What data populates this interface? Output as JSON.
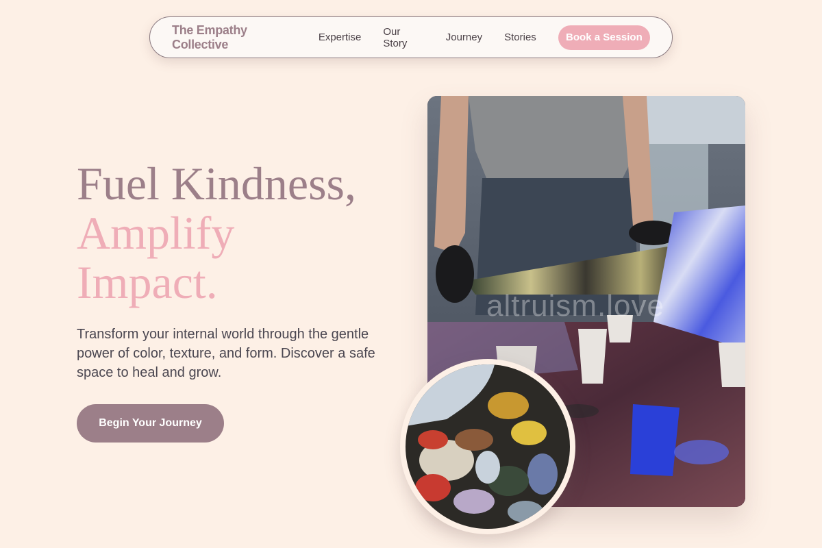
{
  "nav": {
    "brand": "The Empathy Collective",
    "links": [
      "Expertise",
      "Our Story",
      "Journey",
      "Stories"
    ],
    "cta": "Book a Session"
  },
  "hero": {
    "title_line1": "Fuel Kindness,",
    "title_line2": "Amplify",
    "title_line3": "Impact.",
    "subtitle": "Transform your internal world through the gentle power of color, texture, and form. Discover a safe space to heal and grow.",
    "button": "Begin Your Journey"
  },
  "media": {
    "watermark": "altruism.love"
  },
  "colors": {
    "background": "#fdf0e6",
    "mauve": "#9c7f89",
    "pink": "#efadb7",
    "text": "#4a4650"
  }
}
